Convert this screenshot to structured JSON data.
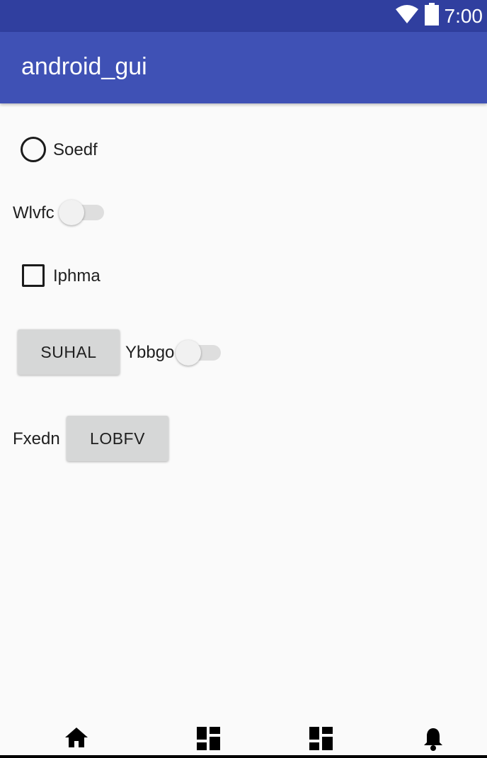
{
  "status_bar": {
    "time": "7:00",
    "icons": [
      "wifi-icon",
      "battery-icon"
    ],
    "background": "#303f9f"
  },
  "app_bar": {
    "title": "android_gui",
    "background": "#3f51b5"
  },
  "form": {
    "radio": {
      "label": "Soedf",
      "checked": false
    },
    "switch1": {
      "label": "Wlvfc",
      "on": false
    },
    "checkbox": {
      "label": "Iphma",
      "checked": false
    },
    "button1": {
      "label": "SUHAL"
    },
    "switch2": {
      "label": "Ybbgo",
      "on": false
    },
    "text_label": "Fxedn",
    "button2": {
      "label": "LOBFV"
    }
  },
  "bottom_nav": {
    "items": [
      "home-icon",
      "dashboard-icon",
      "dashboard-icon",
      "notifications-icon"
    ]
  }
}
